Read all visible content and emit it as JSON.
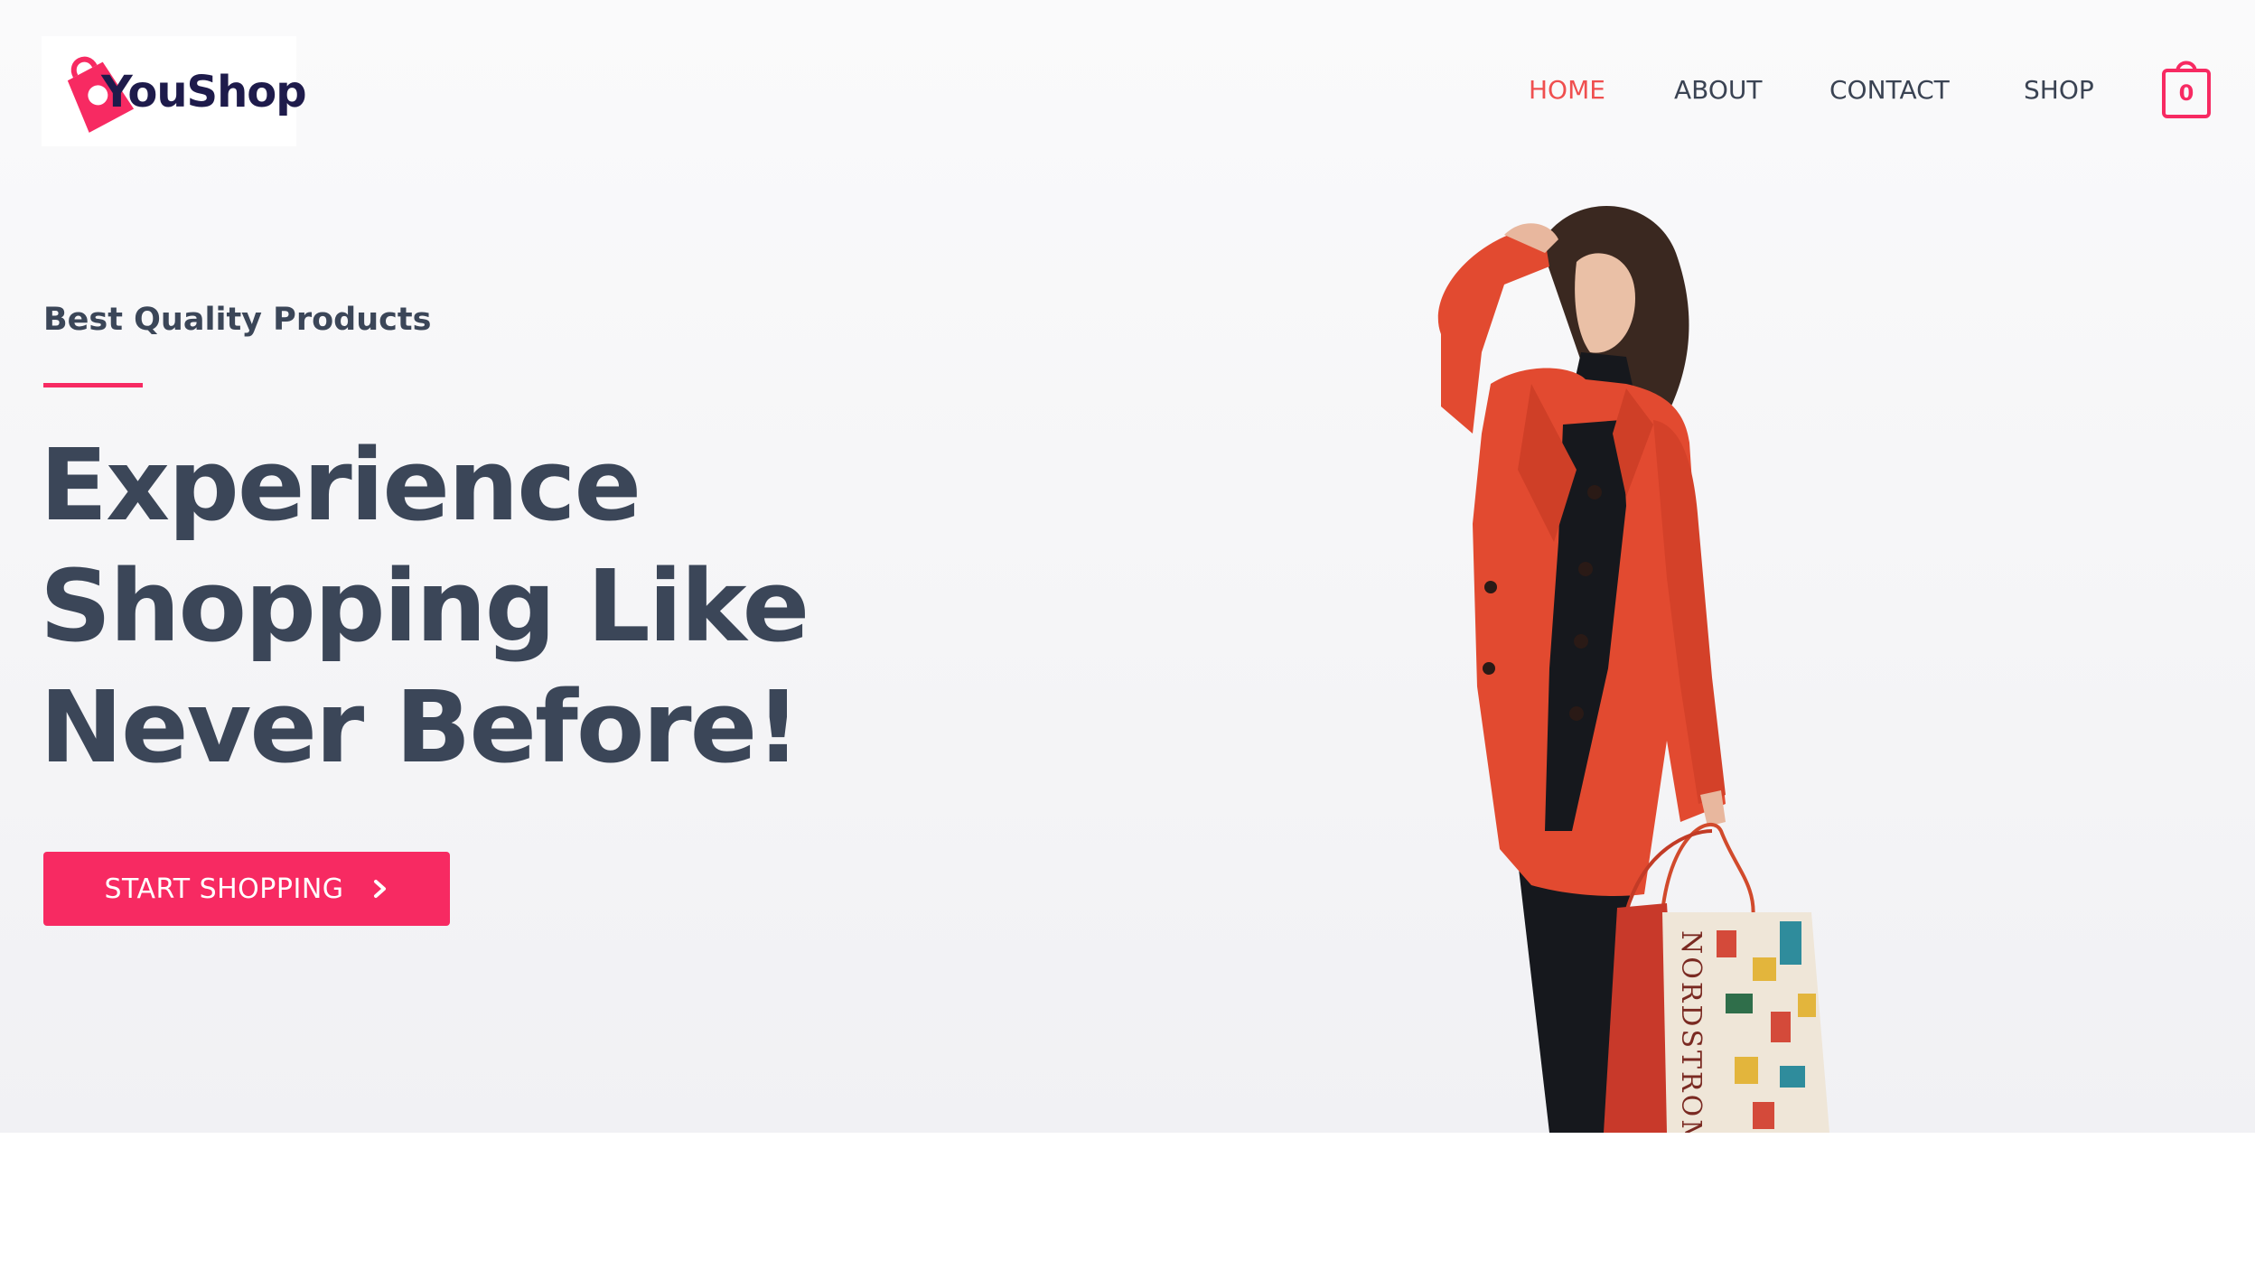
{
  "brand": {
    "name": "YouShop",
    "accent_color": "#f72a62",
    "text_color": "#3b4658",
    "logo_text_color": "#1e1b4b"
  },
  "nav": {
    "items": [
      {
        "label": "HOME",
        "active": true
      },
      {
        "label": "ABOUT",
        "active": false
      },
      {
        "label": "CONTACT",
        "active": false
      },
      {
        "label": "SHOP",
        "active": false
      }
    ],
    "active_color": "#ef4f4f"
  },
  "cart": {
    "icon": "shopping-bag-icon",
    "count": "0"
  },
  "hero": {
    "eyebrow": "Best Quality Products",
    "headline_lines": [
      "Experience",
      "Shopping Like",
      "Never Before!"
    ],
    "cta_label": "START SHOPPING",
    "cta_icon": "chevron-right-icon",
    "image": "woman-in-red-coat-with-shopping-bags",
    "bag_text": "NORDSTROM"
  }
}
